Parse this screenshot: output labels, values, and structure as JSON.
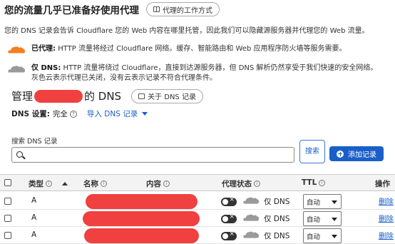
{
  "header": {
    "title": "您的流量几乎已准备好使用代理",
    "how_it_works_button": "代理的工作方式"
  },
  "intro_text": "您的 DNS 记录会告诉 Cloudflare 您的 Web 内容在哪里托管，因此我们可以隐藏源服务器并代理您的 Web 流量。",
  "modes": {
    "proxied_label": "已代理:",
    "proxied_desc": "HTTP 流量将经过 Cloudflare 网络。缓存、智能路由和 Web 应用程序防火墙等服务需要。",
    "dns_only_label": "仅 DNS:",
    "dns_only_desc_line1": "HTTP 流量将绕过 Cloudflare，直接到达源服务器，但 DNS 解析仍然享受于我们快速的安全网络。",
    "dns_only_desc_line2": "灰色云表示代理已关闭，没有云表示记录不符合代理条件。"
  },
  "management": {
    "prefix": "管理",
    "suffix": "的 DNS",
    "about_button": "关于 DNS 记录",
    "settings_label": "DNS 设置:",
    "settings_value": "完全",
    "import_link": "导入 DNS 记录"
  },
  "search": {
    "label": "搜索 DNS 记录",
    "placeholder": "",
    "search_button": "搜索",
    "add_button": "添加记录"
  },
  "table": {
    "headers": {
      "type": "类型",
      "name": "名称",
      "content": "内容",
      "proxy_status": "代理状态",
      "ttl": "TTL",
      "actions": "操作"
    },
    "rows": [
      {
        "type": "A",
        "proxy_label": "仅 DNS",
        "ttl": "自动",
        "action": "删除"
      },
      {
        "type": "A",
        "proxy_label": "仅 DNS",
        "ttl": "自动",
        "action": "删除"
      },
      {
        "type": "A",
        "proxy_label": "仅 DNS",
        "ttl": "自动",
        "action": "删除"
      }
    ]
  },
  "colors": {
    "accent": "#1a5fc9",
    "proxied_cloud": "#f38020",
    "dns_only_cloud": "#9a9a9a",
    "redaction": "#f04040"
  }
}
